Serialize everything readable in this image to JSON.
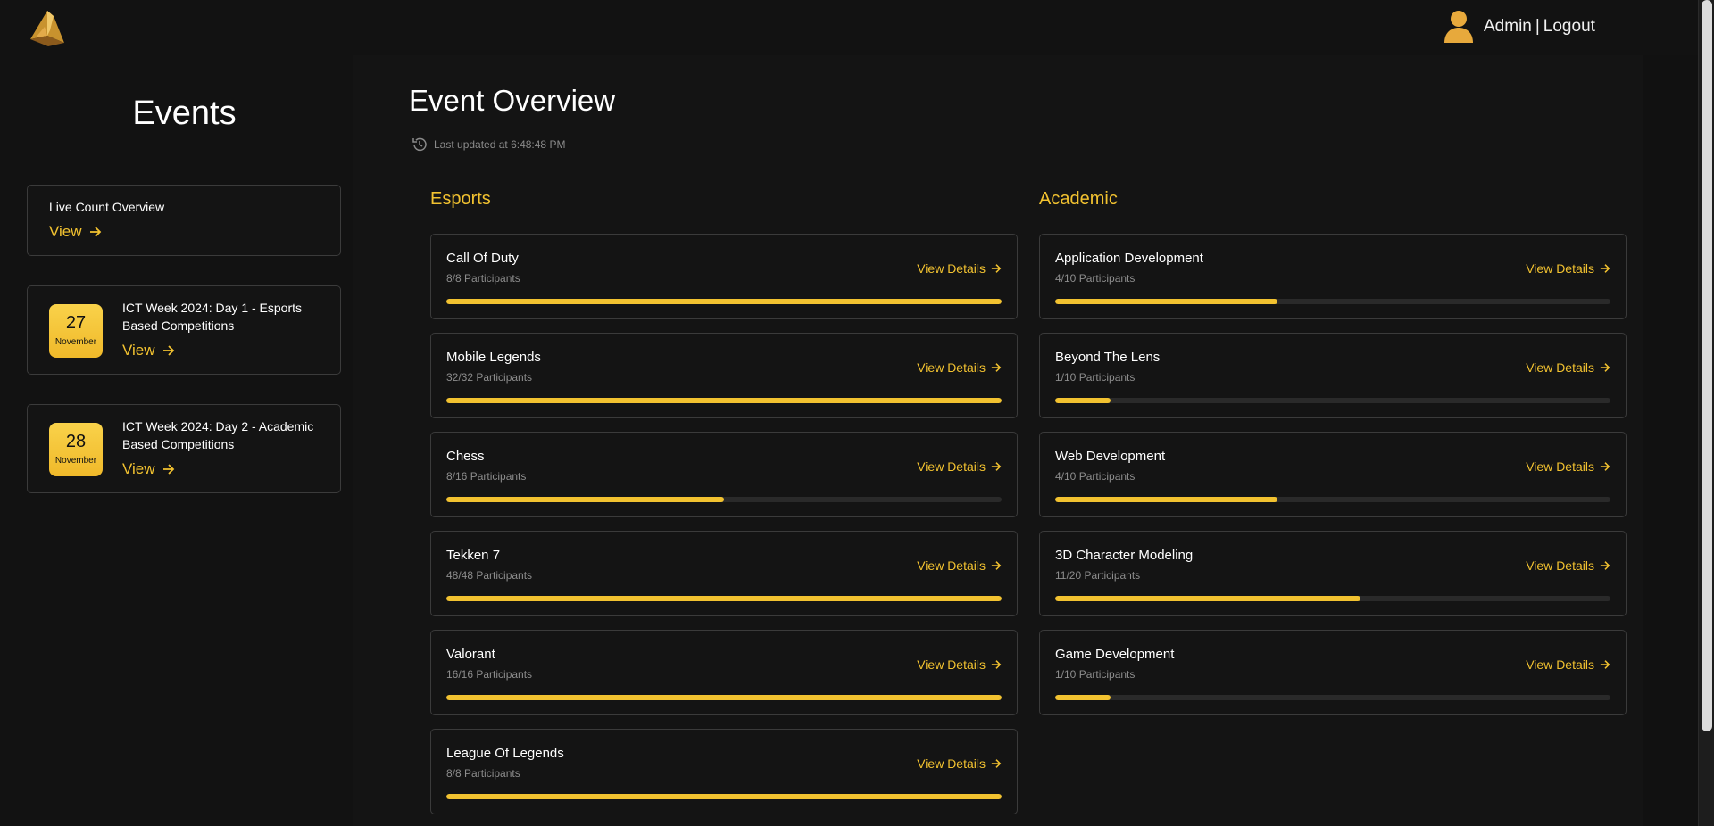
{
  "header": {
    "user_name": "Admin",
    "separator": "|",
    "logout_label": "Logout"
  },
  "sidebar": {
    "title": "Events",
    "live_card": {
      "title": "Live Count Overview",
      "view_label": "View"
    },
    "events": [
      {
        "day": "27",
        "month": "November",
        "title": "ICT Week 2024: Day 1 - Esports Based Competitions",
        "view_label": "View"
      },
      {
        "day": "28",
        "month": "November",
        "title": "ICT Week 2024: Day 2 - Academic Based Competitions",
        "view_label": "View"
      }
    ]
  },
  "main": {
    "title": "Event Overview",
    "last_updated": "Last updated at 6:48:48 PM",
    "details_label": "View Details",
    "columns": [
      {
        "title": "Esports",
        "events": [
          {
            "name": "Call Of Duty",
            "participants": "8/8 Participants",
            "progress": 1.0
          },
          {
            "name": "Mobile Legends",
            "participants": "32/32 Participants",
            "progress": 1.0
          },
          {
            "name": "Chess",
            "participants": "8/16 Participants",
            "progress": 0.5
          },
          {
            "name": "Tekken 7",
            "participants": "48/48 Participants",
            "progress": 1.0
          },
          {
            "name": "Valorant",
            "participants": "16/16 Participants",
            "progress": 1.0
          },
          {
            "name": "League Of Legends",
            "participants": "8/8 Participants",
            "progress": 1.0
          }
        ]
      },
      {
        "title": "Academic",
        "events": [
          {
            "name": "Application Development",
            "participants": "4/10 Participants",
            "progress": 0.4
          },
          {
            "name": "Beyond The Lens",
            "participants": "1/10 Participants",
            "progress": 0.1
          },
          {
            "name": "Web Development",
            "participants": "4/10 Participants",
            "progress": 0.4
          },
          {
            "name": "3D Character Modeling",
            "participants": "11/20 Participants",
            "progress": 0.55
          },
          {
            "name": "Game Development",
            "participants": "1/10 Participants",
            "progress": 0.1
          }
        ]
      }
    ]
  },
  "icons": {
    "logo": "fox-logo-icon",
    "user": "user-icon",
    "history": "history-icon",
    "arrow": "arrow-right-icon"
  },
  "colors": {
    "accent": "#f2c230",
    "background": "#111111",
    "card_border": "#3b3b3b",
    "track": "#2a2a2a"
  }
}
